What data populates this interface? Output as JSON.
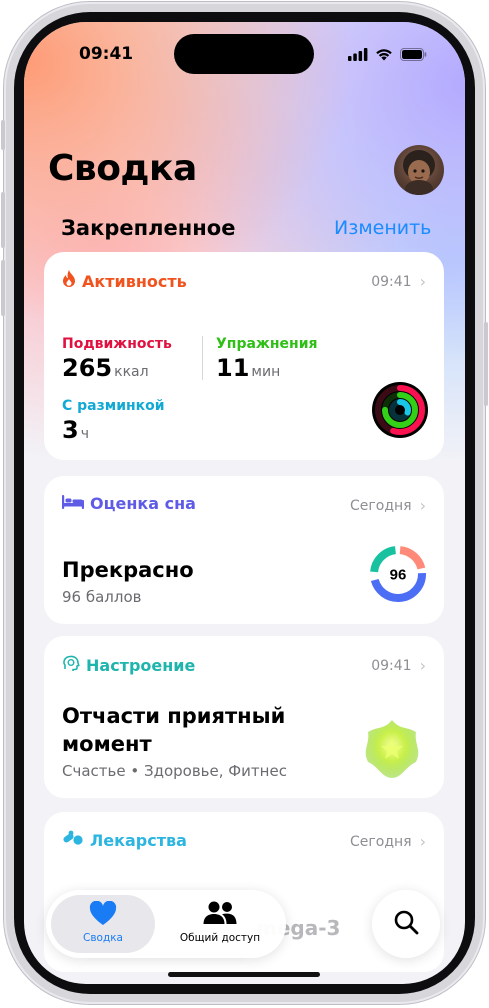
{
  "status_bar": {
    "time": "09:41",
    "icons": [
      "signal-icon",
      "wifi-icon",
      "battery-icon"
    ]
  },
  "page_title": "Сводка",
  "pinned": {
    "label": "Закрепленное",
    "edit_label": "Изменить"
  },
  "activity": {
    "title": "Активность",
    "time": "09:41",
    "move_label": "Подвижность",
    "move_value": "265",
    "move_unit": "ккал",
    "exercise_label": "Упражнения",
    "exercise_value": "11",
    "exercise_unit": "мин",
    "stand_label": "С разминкой",
    "stand_value": "3",
    "stand_unit": "ч",
    "rings": {
      "move_fraction": 0.55,
      "exercise_fraction": 0.75,
      "stand_fraction": 0.3
    },
    "colors": {
      "move": "#fa114f",
      "exercise": "#33d017",
      "stand": "#18c8e6"
    }
  },
  "sleep": {
    "title": "Оценка сна",
    "date": "Сегодня",
    "rating": "Прекрасно",
    "score_text": "96 баллов",
    "score": "96",
    "colors": {
      "accent": "#5e5ce6"
    }
  },
  "mood": {
    "title": "Настроение",
    "time": "09:41",
    "state_line1": "Отчасти приятный",
    "state_line2": "момент",
    "tags": "Счастье • Здоровье, Фитнес",
    "colors": {
      "accent": "#1fb5ad"
    }
  },
  "meds": {
    "title": "Лекарства",
    "date": "Сегодня",
    "faded_item": "mega-3",
    "colors": {
      "accent": "#2cb5e0"
    }
  },
  "tabs": [
    {
      "label": "Сводка",
      "icon": "heart-icon"
    },
    {
      "label": "Общий доступ",
      "icon": "people-icon"
    }
  ],
  "search": {
    "icon": "search-icon"
  },
  "colors": {
    "link": "#1a8cff",
    "activity_orange": "#f0531e"
  }
}
